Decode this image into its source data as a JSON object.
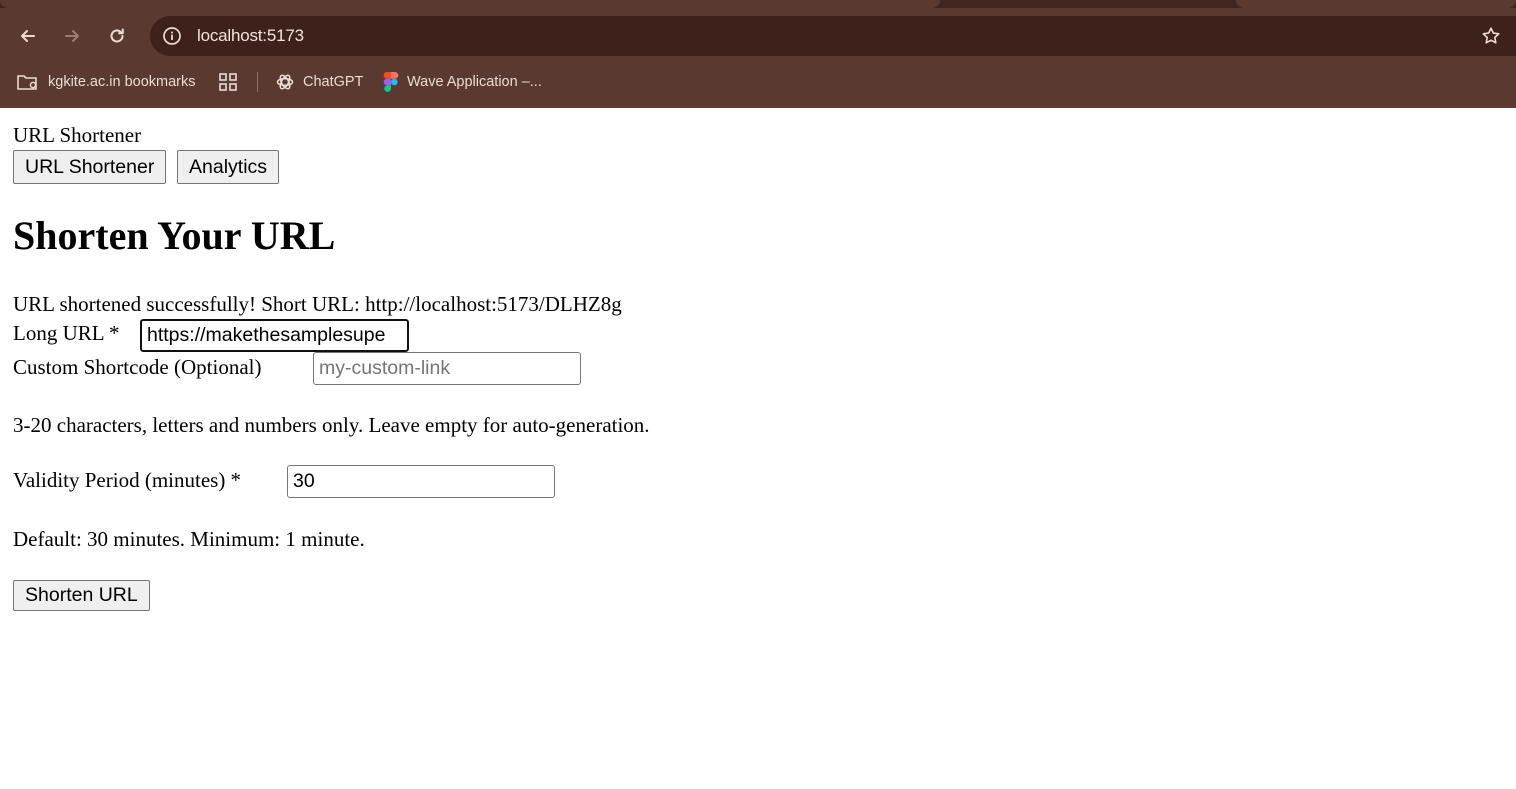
{
  "browser": {
    "url": "localhost:5173",
    "bookmarks": [
      {
        "label": "kgkite.ac.in bookmarks",
        "icon": "folder-settings-icon"
      },
      {
        "label": "",
        "icon": "apps-grid-icon"
      },
      {
        "label": "ChatGPT",
        "icon": "chatgpt-icon"
      },
      {
        "label": "Wave Application –...",
        "icon": "figma-icon"
      }
    ],
    "colors": {
      "frame": "#5a3a30",
      "omnibox": "#3f211c",
      "text": "#f1e4df"
    }
  },
  "app": {
    "title": "URL Shortener",
    "nav": [
      "URL Shortener",
      "Analytics"
    ]
  },
  "form": {
    "heading": "Shorten Your URL",
    "success_message": "URL shortened successfully! Short URL: http://localhost:5173/DLHZ8g",
    "long_url_label": "Long URL *",
    "long_url_value": "https://makethesamplesupe",
    "shortcode_label": "Custom Shortcode (Optional)",
    "shortcode_placeholder": "my-custom-link",
    "shortcode_help": "3-20 characters, letters and numbers only. Leave empty for auto-generation.",
    "validity_label": "Validity Period (minutes) *",
    "validity_value": "30",
    "validity_help": "Default: 30 minutes. Minimum: 1 minute.",
    "submit_label": "Shorten URL"
  }
}
